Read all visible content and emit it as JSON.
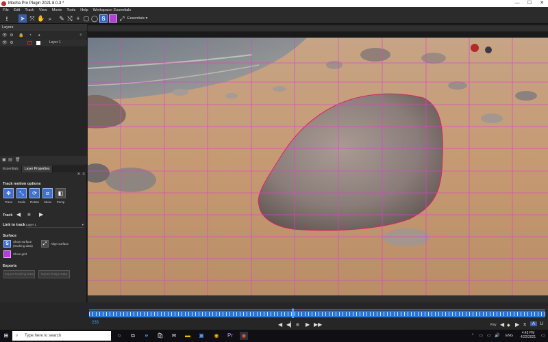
{
  "window": {
    "title": "Mocha Pro Plugin 2021 8.0.3 *",
    "minimize": "—",
    "maximize": "☐",
    "close": "✕"
  },
  "menu": [
    "File",
    "Edit",
    "Track",
    "View",
    "Movie",
    "Tools",
    "Help",
    "Workspace: Essentials"
  ],
  "toolbar": {
    "icons": [
      "save-icon",
      "select-tool-icon",
      "select-points-icon",
      "hand-tool-icon",
      "zoom-tool-icon",
      "bezier-spline-icon",
      "xspline-icon",
      "add-point-icon",
      "rect-spline-icon",
      "circle-spline-icon",
      "surface-icon",
      "grid-icon",
      "align-surface-icon"
    ],
    "workspace_value": "Essentials"
  },
  "layers_panel": {
    "title": "Layers",
    "layer_name": "Layer 1"
  },
  "tabs": [
    "Essentials",
    "Layer Properties"
  ],
  "track_motion": {
    "title": "Track motion options",
    "buttons": [
      {
        "label": "Trans",
        "glyph": "✥",
        "active": true
      },
      {
        "label": "Scale",
        "glyph": "⤡",
        "active": true
      },
      {
        "label": "Rotate",
        "glyph": "⟳",
        "active": true
      },
      {
        "label": "Skew",
        "glyph": "⧄",
        "active": true
      },
      {
        "label": "Persp",
        "glyph": "◧",
        "active": false
      }
    ]
  },
  "track": {
    "label": "Track",
    "back": "◀",
    "stop": "■",
    "forward": "▶"
  },
  "link_to_track": {
    "label": "Link to track",
    "value": "Layer 1"
  },
  "surface": {
    "title": "Surface",
    "show_surface": "Show surface (tracking data)",
    "align_surface": "Align surface",
    "show_grid": "Show grid",
    "colors": {
      "surface": "#2f63c9",
      "grid": "#b43fd9"
    }
  },
  "exports": {
    "title": "Exports",
    "buttons": [
      "Export Tracking Data",
      "Export Shape Data"
    ]
  },
  "timeline": {
    "frame": "233",
    "key_label": "Key",
    "buttons": [
      "◀",
      "◀▏",
      "■",
      "▶",
      "▶▶"
    ]
  },
  "taskbar": {
    "search_placeholder": "Type here to search",
    "language": "ENG",
    "time": "4:43 PM",
    "date": "4/22/2021"
  },
  "colors": {
    "accent": "#2a74d6",
    "grid_line": "#e040c8",
    "panel_bg": "#2a2a2a"
  }
}
